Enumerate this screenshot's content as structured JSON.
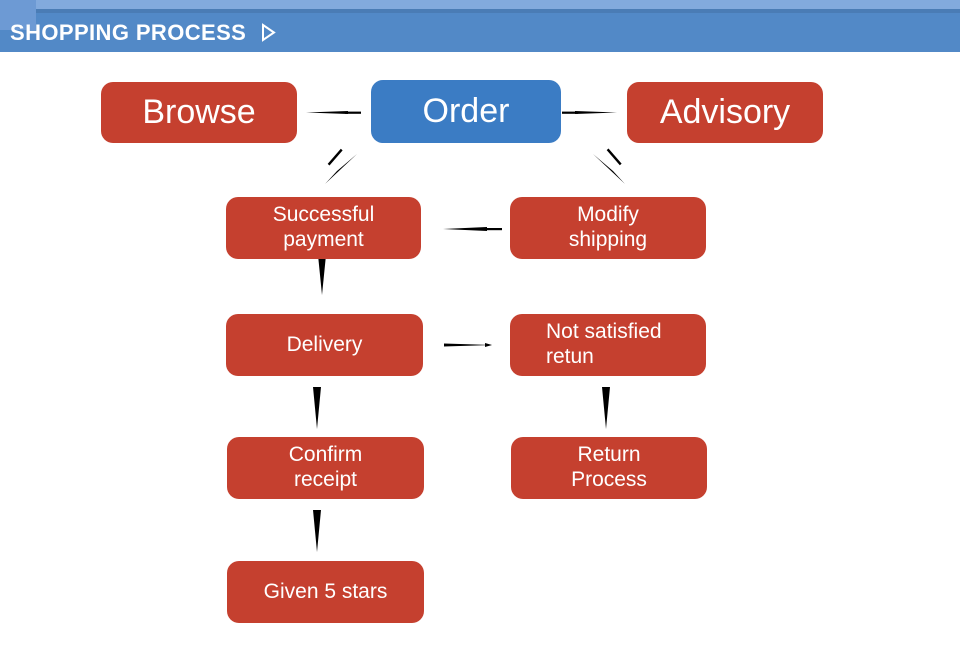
{
  "header": {
    "title": "SHOPPING PROCESS",
    "marker_icon": "play-triangle-icon",
    "bg_color": "#5289c7",
    "top_strip_color": "#82aadd",
    "text_color": "#ffffff"
  },
  "colors": {
    "node_red": "#c5402f",
    "node_blue": "#3b7cc4",
    "arrow": "#000000",
    "canvas": "#ffffff"
  },
  "diagram": {
    "type": "flowchart",
    "nodes": [
      {
        "id": "browse",
        "label": "Browse",
        "color": "red",
        "size": "big",
        "align": "center"
      },
      {
        "id": "order",
        "label": "Order",
        "color": "blue",
        "size": "big",
        "align": "center"
      },
      {
        "id": "advisory",
        "label": "Advisory",
        "color": "red",
        "size": "big",
        "align": "center"
      },
      {
        "id": "successful",
        "label": "Successful\npayment",
        "color": "red",
        "size": "small",
        "align": "center"
      },
      {
        "id": "modify",
        "label": "Modify\nshipping",
        "color": "red",
        "size": "small",
        "align": "center"
      },
      {
        "id": "delivery",
        "label": "Delivery",
        "color": "red",
        "size": "small",
        "align": "center"
      },
      {
        "id": "notsat",
        "label": "Not satisfied\nretun",
        "color": "red",
        "size": "small",
        "align": "left"
      },
      {
        "id": "confirm",
        "label": "Confirm\nreceipt",
        "color": "red",
        "size": "small",
        "align": "center"
      },
      {
        "id": "returnproc",
        "label": "Return\nProcess",
        "color": "red",
        "size": "small",
        "align": "center"
      },
      {
        "id": "stars",
        "label": "Given 5 stars",
        "color": "red",
        "size": "small",
        "align": "center"
      }
    ],
    "edges": [
      {
        "from": "order",
        "to": "browse",
        "direction": "left"
      },
      {
        "from": "order",
        "to": "advisory",
        "direction": "right"
      },
      {
        "from": "order",
        "to": "successful",
        "direction": "down-left"
      },
      {
        "from": "order",
        "to": "modify",
        "direction": "down-right"
      },
      {
        "from": "modify",
        "to": "successful",
        "direction": "left"
      },
      {
        "from": "successful",
        "to": "delivery",
        "direction": "down"
      },
      {
        "from": "delivery",
        "to": "notsat",
        "direction": "right"
      },
      {
        "from": "delivery",
        "to": "confirm",
        "direction": "down"
      },
      {
        "from": "notsat",
        "to": "returnproc",
        "direction": "down"
      },
      {
        "from": "confirm",
        "to": "stars",
        "direction": "down"
      }
    ]
  }
}
